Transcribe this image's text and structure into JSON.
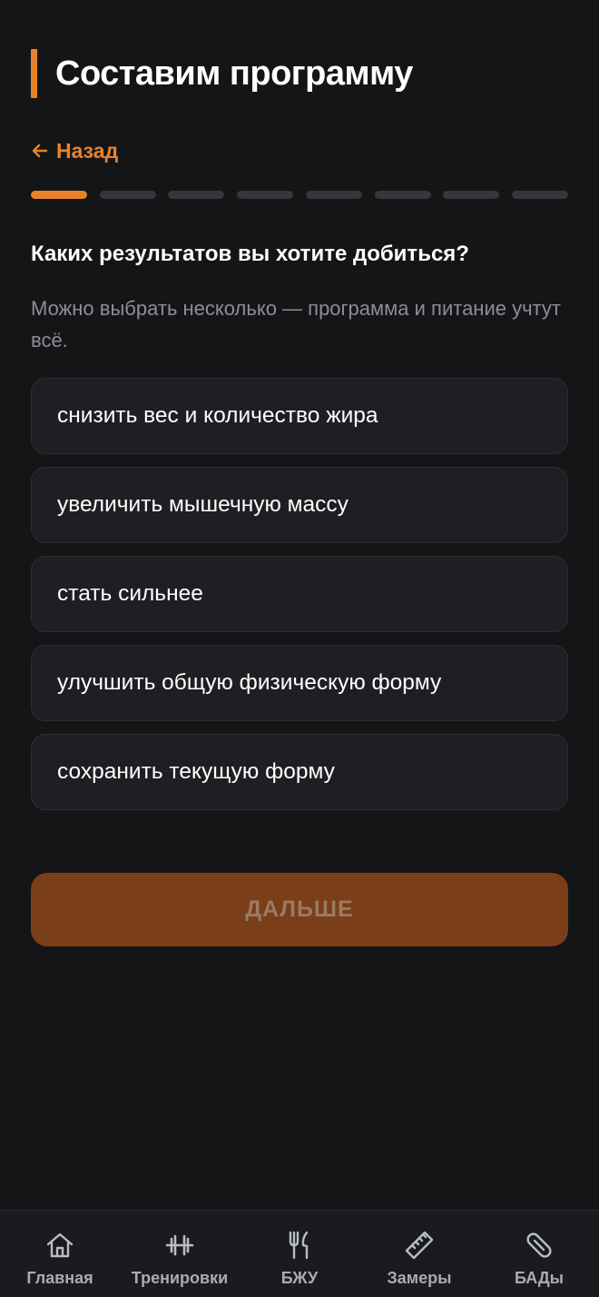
{
  "header": {
    "title": "Составим программу"
  },
  "nav": {
    "back_label": "Назад"
  },
  "progress": {
    "total_steps": 8,
    "current_step": 1
  },
  "question": {
    "title": "Каких результатов вы хотите добиться?",
    "hint": "Можно выбрать несколько — программа и питание учтут всё."
  },
  "options": [
    {
      "label": "снизить вес и количество жира"
    },
    {
      "label": "увеличить мышечную массу"
    },
    {
      "label": "стать сильнее"
    },
    {
      "label": "улучшить общую физическую форму"
    },
    {
      "label": "сохранить текущую форму"
    }
  ],
  "next_button": {
    "label": "ДАЛЬШЕ"
  },
  "tabbar": {
    "items": [
      {
        "label": "Главная",
        "icon": "home-icon"
      },
      {
        "label": "Тренировки",
        "icon": "dumbbell-icon"
      },
      {
        "label": "БЖУ",
        "icon": "fork-knife-icon"
      },
      {
        "label": "Замеры",
        "icon": "ruler-icon"
      },
      {
        "label": "БАДы",
        "icon": "pill-icon"
      }
    ]
  },
  "colors": {
    "accent": "#e8822a",
    "background": "#141517",
    "card": "#1e1f22",
    "button_disabled": "#7a3f19"
  }
}
